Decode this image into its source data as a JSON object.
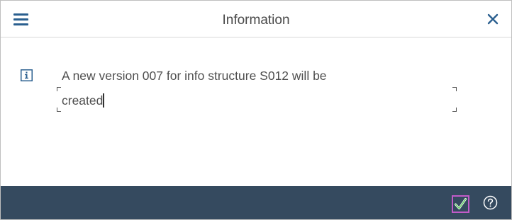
{
  "dialog": {
    "title": "Information",
    "message_line1": "A new version 007 for info structure S012 will be",
    "message_line2": "created"
  },
  "icons": {
    "menu": "hamburger-menu-icon",
    "close": "close-icon",
    "info": "info-icon",
    "ok": "checkmark-icon",
    "help": "question-mark-icon"
  },
  "colors": {
    "accent": "#2a5f8f",
    "footer": "#354a5f",
    "ok_focus": "#c15bc8",
    "ok_check": "#6dd06d"
  }
}
